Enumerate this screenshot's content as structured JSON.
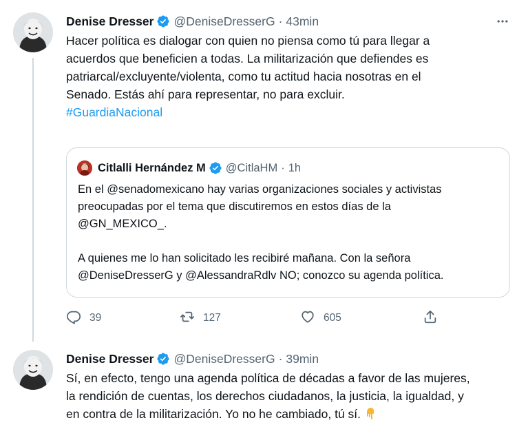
{
  "tweets": [
    {
      "author": {
        "name": "Denise Dresser",
        "handle": "@DeniseDresserG",
        "avatar_icon": "avatar-photo",
        "verified_icon": "verified-badge-icon"
      },
      "time": "43min",
      "separator": "·",
      "lines": [
        "Hacer política es dialogar con quien no piensa como tú para llegar a",
        "acuerdos que beneficien a todas. La militarización que defiendes es",
        "patriarcal/excluyente/violenta, como tu actitud hacia nosotras en el",
        "Senado. Estás ahí para representar, no para excluir."
      ],
      "hashtag": "#GuardiaNacional",
      "quote": {
        "author": {
          "name": "Citlalli Hernández M",
          "handle": "@CitlaHM"
        },
        "separator": "·",
        "time": "1h",
        "paragraph_1": [
          "En el @senadomexicano hay varias organizaciones sociales y activistas",
          "preocupadas por el tema que discutiremos en estos días de la",
          "@GN_MEXICO_."
        ],
        "paragraph_2": [
          "A quienes me lo han solicitado les recibiré mañana. Con la señora",
          "@DeniseDresserG y @AlessandraRdlv NO; conozco su agenda política."
        ]
      },
      "actions": {
        "replies": "39",
        "retweets": "127",
        "likes": "605"
      }
    },
    {
      "author": {
        "name": "Denise Dresser",
        "handle": "@DeniseDresserG",
        "avatar_icon": "avatar-photo",
        "verified_icon": "verified-badge-icon"
      },
      "time": "39min",
      "separator": "·",
      "lines": [
        "Sí, en efecto, tengo una agenda política de décadas a favor de las mujeres,",
        "la rendición de cuentas, los derechos ciudadanos, la justicia, la igualdad, y",
        "en contra de la militarización. Yo no he cambiado, tú sí."
      ],
      "emoji": "pointing-down-hand-emoji"
    }
  ],
  "colors": {
    "link": "#1d9bf0",
    "secondary_text": "#536471",
    "primary_text": "#0f1419",
    "border": "#cfd9de",
    "verified": "#1d9bf0"
  }
}
